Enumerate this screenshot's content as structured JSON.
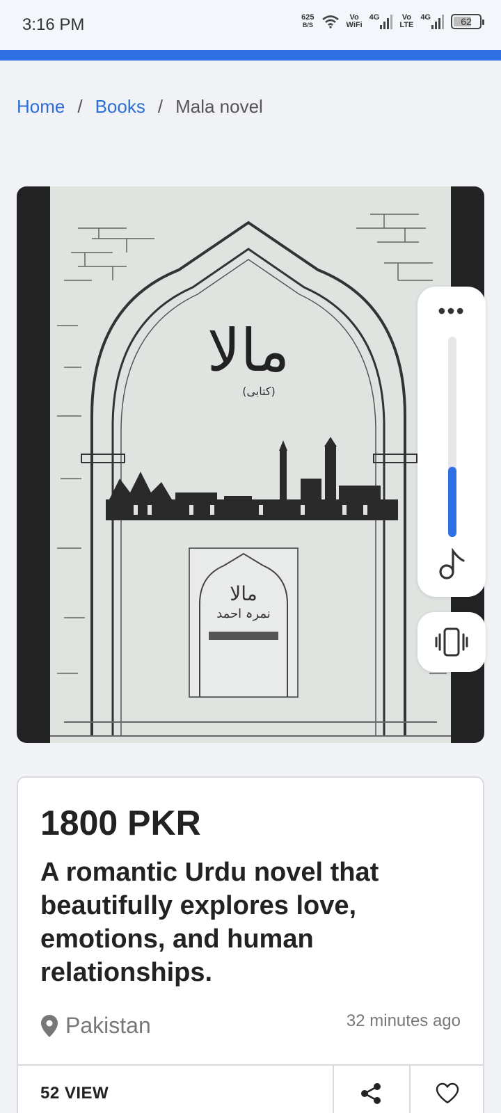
{
  "status_bar": {
    "time": "3:16 PM",
    "net_speed_value": "625",
    "net_speed_unit": "B/S",
    "vowifi_top": "Vo",
    "vowifi_bottom": "WiFi",
    "network_1": "4G",
    "volte_top": "Vo",
    "volte_bottom": "LTE",
    "network_2": "4G",
    "battery": "62"
  },
  "breadcrumb": {
    "home": "Home",
    "separator": "/",
    "books": "Books",
    "current": "Mala novel"
  },
  "cover": {
    "title": "مالا",
    "subtitle": "(کتابی)",
    "inner_title": "مالا",
    "inner_author": "نمرہ احمد"
  },
  "sound_panel": {
    "more_label": "•••",
    "volume_level": 0.35
  },
  "listing": {
    "price": "1800 PKR",
    "description": "A romantic Urdu novel that beautifully explores love, emotions, and human relationships.",
    "location": "Pakistan",
    "posted": "32 minutes ago",
    "views": "52 VIEW"
  },
  "colors": {
    "accent": "#2f6fe4",
    "link": "#2b6fd6",
    "background": "#f1f2f5"
  }
}
